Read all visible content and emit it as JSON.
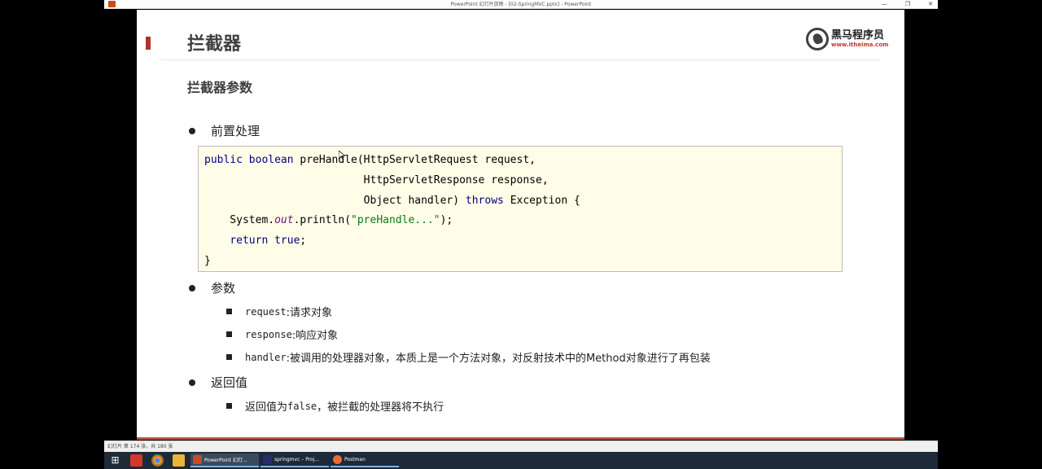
{
  "window": {
    "title": "PowerPoint 幻灯片放映 - [02-SpringMVC.pptx] - PowerPoint",
    "controls": [
      "—",
      "❐",
      "✕"
    ]
  },
  "slide": {
    "heading": "拦截器",
    "logo": {
      "name": "黑马程序员",
      "url": "www.itheima.com"
    },
    "subheading": "拦截器参数",
    "bullets": {
      "pre": "前置处理",
      "params": "参数",
      "ret": "返回值"
    },
    "code": {
      "line1_kw": "public boolean",
      "line1_rest": " preHandle(HttpServletRequest request,",
      "line2": "                         HttpServletResponse response,",
      "line3_a": "                         Object handler) ",
      "line3_kw": "throws",
      "line3_b": " Exception {",
      "line4_a": "    System.",
      "line4_fld": "out",
      "line4_b": ".println(",
      "line4_str": "\"preHandle...\"",
      "line4_c": ");",
      "line5_kw": "return true",
      "line5_b": ";",
      "line6": "}"
    },
    "params": [
      {
        "code": "request",
        "text": ":请求对象"
      },
      {
        "code": "response",
        "text": ":响应对象"
      },
      {
        "code": "handler",
        "text": ":被调用的处理器对象，本质上是一个方法对象，对反射技术中的Method对象进行了再包装"
      }
    ],
    "return": {
      "prefix": "返回值为",
      "code": "false",
      "text": "，被拦截的处理器将不执行"
    }
  },
  "status": {
    "slide_counter": "幻灯片 第 174 张，共 180 张"
  },
  "taskbar": {
    "apps": [
      "PowerPoint 幻灯...",
      "springmvc – Proj...",
      "Postman"
    ]
  },
  "colors": {
    "accent": "#b5312b",
    "code_bg": "#fffde7",
    "keyword": "#000080",
    "string": "#067d17"
  }
}
